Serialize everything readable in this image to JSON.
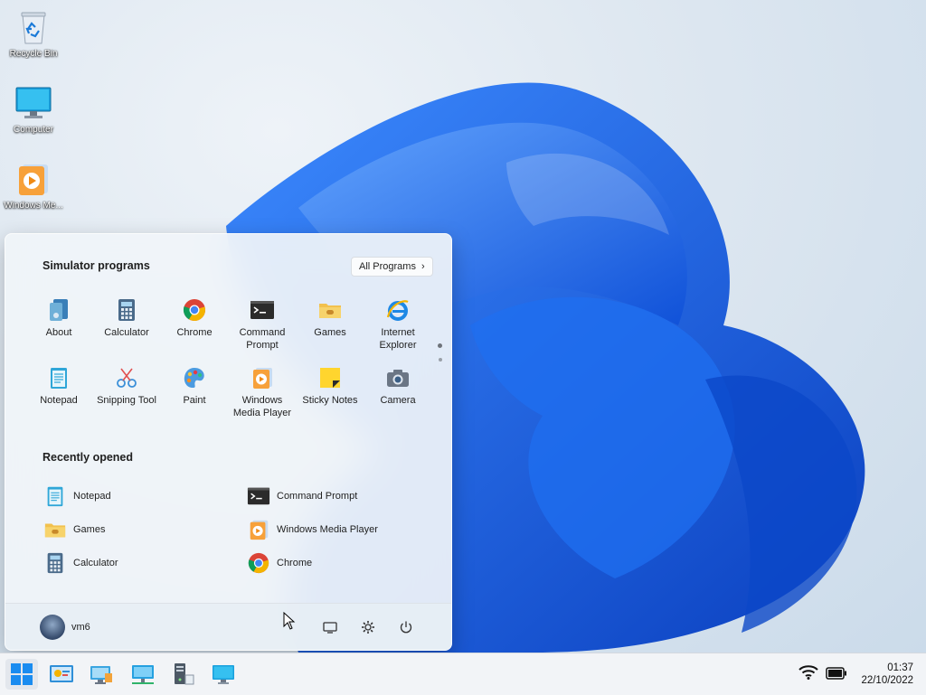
{
  "desktop": {
    "icons": [
      {
        "label": "Recycle Bin",
        "icon": "recycle-bin-icon"
      },
      {
        "label": "Computer",
        "icon": "monitor-icon"
      },
      {
        "label": "Windows Me...",
        "icon": "media-player-icon"
      }
    ]
  },
  "start_menu": {
    "pinned_title": "Simulator programs",
    "all_programs_label": "All Programs",
    "pinned": [
      {
        "label": "About",
        "icon": "about-icon"
      },
      {
        "label": "Calculator",
        "icon": "calculator-icon"
      },
      {
        "label": "Chrome",
        "icon": "chrome-icon"
      },
      {
        "label": "Command Prompt",
        "icon": "terminal-icon"
      },
      {
        "label": "Games",
        "icon": "games-folder-icon"
      },
      {
        "label": "Internet Explorer",
        "icon": "internet-explorer-icon"
      },
      {
        "label": "Notepad",
        "icon": "notepad-icon"
      },
      {
        "label": "Snipping Tool",
        "icon": "scissors-icon"
      },
      {
        "label": "Paint",
        "icon": "paint-palette-icon"
      },
      {
        "label": "Windows Media Player",
        "icon": "media-player-icon"
      },
      {
        "label": "Sticky Notes",
        "icon": "sticky-note-icon"
      },
      {
        "label": "Camera",
        "icon": "camera-icon"
      }
    ],
    "recent_title": "Recently opened",
    "recent": [
      {
        "label": "Notepad",
        "icon": "notepad-icon"
      },
      {
        "label": "Command Prompt",
        "icon": "terminal-icon"
      },
      {
        "label": "Games",
        "icon": "games-folder-icon"
      },
      {
        "label": "Windows Media Player",
        "icon": "media-player-icon"
      },
      {
        "label": "Calculator",
        "icon": "calculator-icon"
      },
      {
        "label": "Chrome",
        "icon": "chrome-icon"
      }
    ],
    "user_name": "vm6",
    "footer_buttons": [
      "display-icon",
      "gear-icon",
      "power-icon"
    ]
  },
  "taskbar": {
    "pinned_icons": [
      "start-icon",
      "control-panel-icon",
      "display-settings-icon",
      "network-icon",
      "computer-tower-icon",
      "monitor-icon"
    ],
    "tray": {
      "wifi": "wifi-icon",
      "battery": "battery-icon"
    },
    "time": "01:37",
    "date": "22/10/2022"
  },
  "colors": {
    "accent": "#0067c0",
    "wallpaper_blue": "#1565e8",
    "menu_bg": "#f0f4f9"
  }
}
